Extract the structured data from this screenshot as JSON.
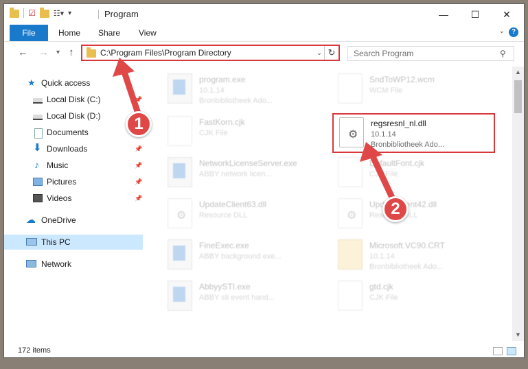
{
  "window": {
    "title": "Program",
    "minimize_glyph": "—",
    "maximize_glyph": "☐",
    "close_glyph": "✕"
  },
  "ribbon": {
    "tabs": [
      "File",
      "Home",
      "Share",
      "View"
    ],
    "help_glyph": "?"
  },
  "nav": {
    "back_glyph": "←",
    "forward_glyph": "→",
    "recent_glyph": "▾",
    "up_glyph": "↑",
    "address": "C:\\Program Files\\Program Directory",
    "refresh_glyph": "↻",
    "search_placeholder": "Search Program",
    "search_glyph": "⚲"
  },
  "sidebar": {
    "items": [
      {
        "label": "Quick access",
        "icon": "star-icon",
        "pinned": false
      },
      {
        "label": "Local Disk (C:)",
        "icon": "drive-icon",
        "pinned": true
      },
      {
        "label": "Local Disk (D:)",
        "icon": "drive-icon",
        "pinned": false
      },
      {
        "label": "Documents",
        "icon": "documents-icon",
        "pinned": true
      },
      {
        "label": "Downloads",
        "icon": "download-icon",
        "pinned": true
      },
      {
        "label": "Music",
        "icon": "music-icon",
        "pinned": true
      },
      {
        "label": "Pictures",
        "icon": "pictures-icon",
        "pinned": true
      },
      {
        "label": "Videos",
        "icon": "videos-icon",
        "pinned": true
      },
      {
        "label": "OneDrive",
        "icon": "cloud-icon",
        "pinned": false
      },
      {
        "label": "This PC",
        "icon": "computer-icon",
        "pinned": false,
        "selected": true
      },
      {
        "label": "Network",
        "icon": "network-icon",
        "pinned": false
      }
    ]
  },
  "files": [
    {
      "name": "program.exe",
      "line2": "10.1.14",
      "line3": "Bronbibliotheek Ado...",
      "icon": "exe"
    },
    {
      "name": "SndToWP12.wcm",
      "line2": "WCM File",
      "line3": "",
      "icon": "doc"
    },
    {
      "name": "FastKorn.cjk",
      "line2": "CJK File",
      "line3": "",
      "icon": "doc"
    },
    {
      "name": "regsresnl_nl.dll",
      "line2": "10.1.14",
      "line3": "Bronbibliotheek Ado...",
      "icon": "dll",
      "highlight": true
    },
    {
      "name": "NetworkLicenseServer.exe",
      "line2": "ABBY network licen...",
      "line3": "",
      "icon": "exe"
    },
    {
      "name": "DefaultFont.cjk",
      "line2": "CJK File",
      "line3": "",
      "icon": "doc"
    },
    {
      "name": "UpdateClient63.dll",
      "line2": "Resource DLL",
      "line3": "",
      "icon": "dll"
    },
    {
      "name": "UpdateClient42.dll",
      "line2": "Resource DLL",
      "line3": "",
      "icon": "dll"
    },
    {
      "name": "FineExec.exe",
      "line2": "ABBY background exe...",
      "line3": "",
      "icon": "exe"
    },
    {
      "name": "Microsoft.VC90.CRT",
      "line2": "10.1.14",
      "line3": "Bronbibliotheek Ado...",
      "icon": "zip"
    },
    {
      "name": "AbbyySTI.exe",
      "line2": "ABBY sti event hand...",
      "line3": "",
      "icon": "exe"
    },
    {
      "name": "gtd.cjk",
      "line2": "CJK File",
      "line3": "",
      "icon": "doc"
    }
  ],
  "status": {
    "item_count": "172 items"
  },
  "annotations": {
    "step1": "1",
    "step2": "2",
    "color": "#e04848"
  }
}
